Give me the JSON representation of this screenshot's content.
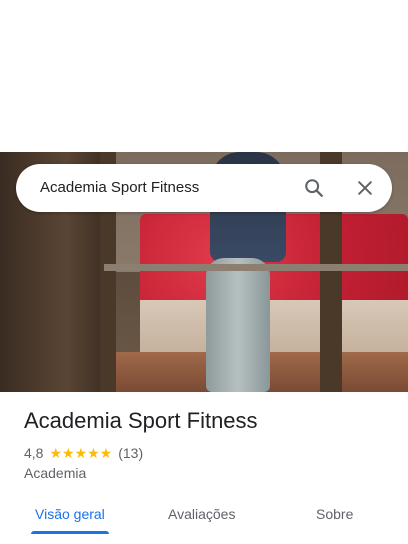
{
  "search": {
    "query": "Academia Sport Fitness",
    "search_icon": "search-icon",
    "close_icon": "close-icon"
  },
  "place": {
    "name": "Academia Sport Fitness",
    "rating": "4,8",
    "rating_value": 4.8,
    "stars": "★★★★★",
    "reviews_count": "(13)",
    "category": "Academia"
  },
  "tabs": [
    {
      "label": "Visão geral",
      "active": true
    },
    {
      "label": "Avaliações",
      "active": false
    },
    {
      "label": "Sobre",
      "active": false
    }
  ],
  "colors": {
    "accent": "#1a73e8",
    "star": "#fbbc04",
    "text_primary": "#202124",
    "text_secondary": "#5f6368"
  }
}
